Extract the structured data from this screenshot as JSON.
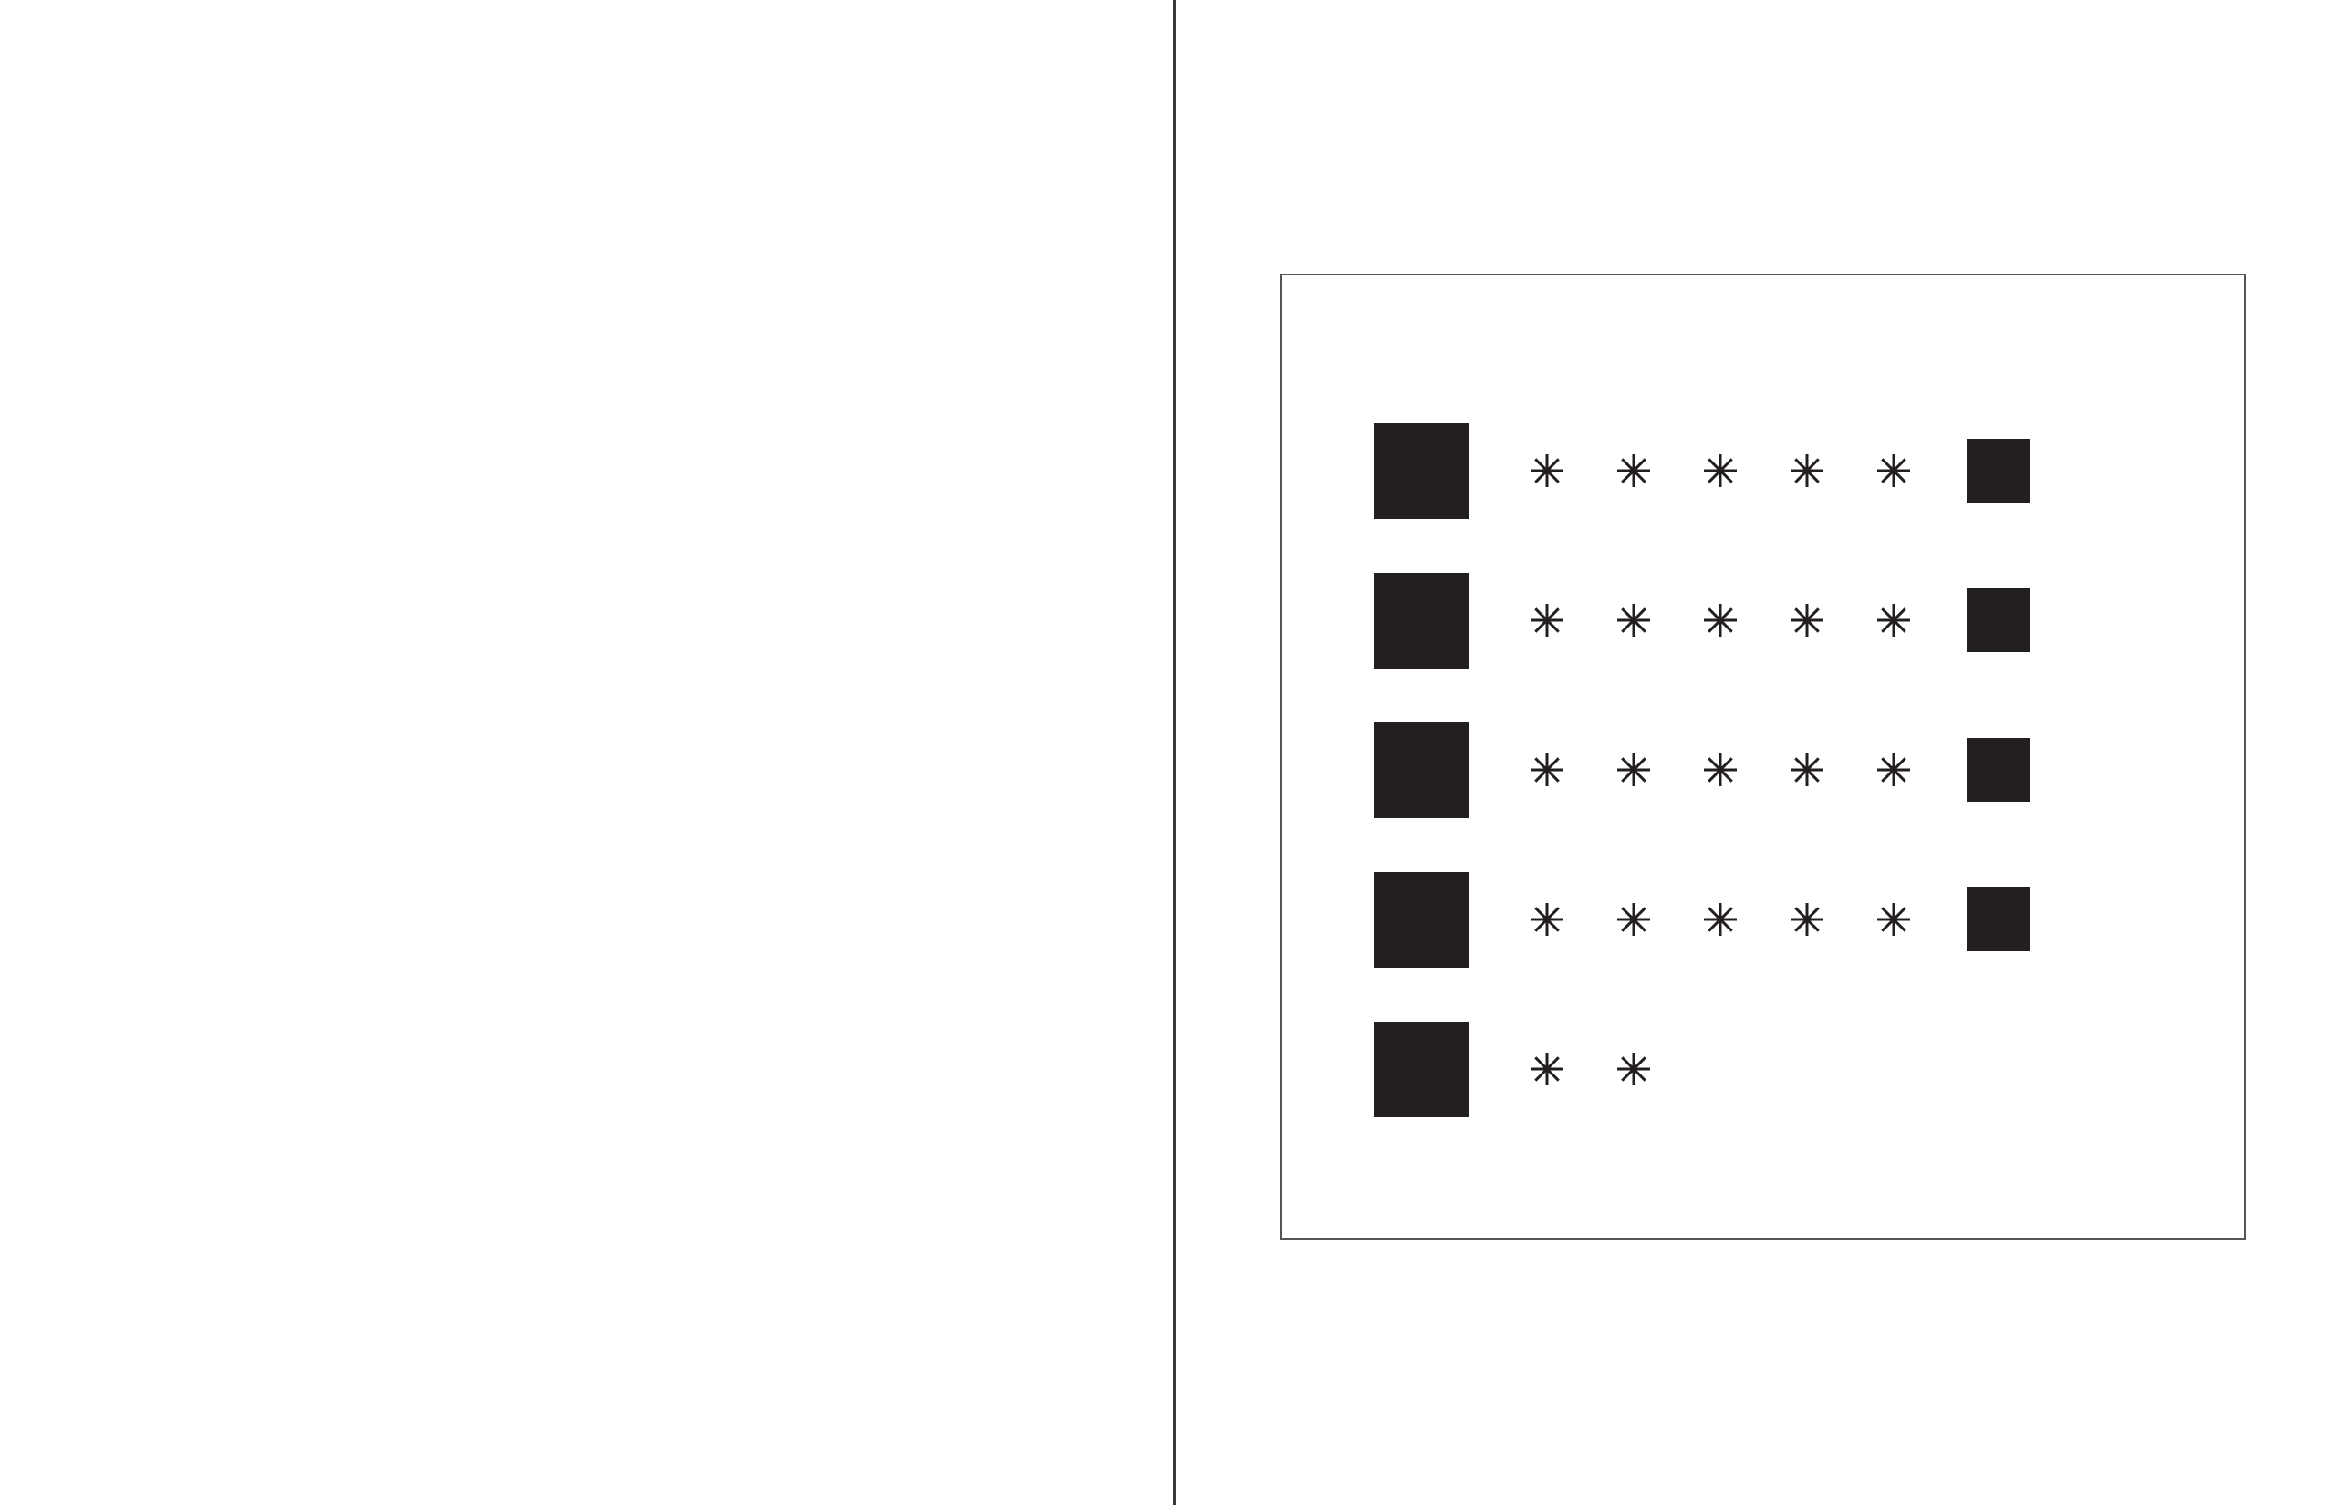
{
  "colors": {
    "ink": "#231f20",
    "frame": "#555555",
    "spine": "#3a3a3a",
    "background": "#ffffff"
  },
  "icons": {
    "row_start": "filled-square-icon",
    "counter": "asterisk-icon",
    "row_end": "filled-square-icon"
  },
  "rows": [
    {
      "stars": 5,
      "end_square": true
    },
    {
      "stars": 5,
      "end_square": true
    },
    {
      "stars": 5,
      "end_square": true
    },
    {
      "stars": 5,
      "end_square": true
    },
    {
      "stars": 2,
      "end_square": false
    }
  ]
}
